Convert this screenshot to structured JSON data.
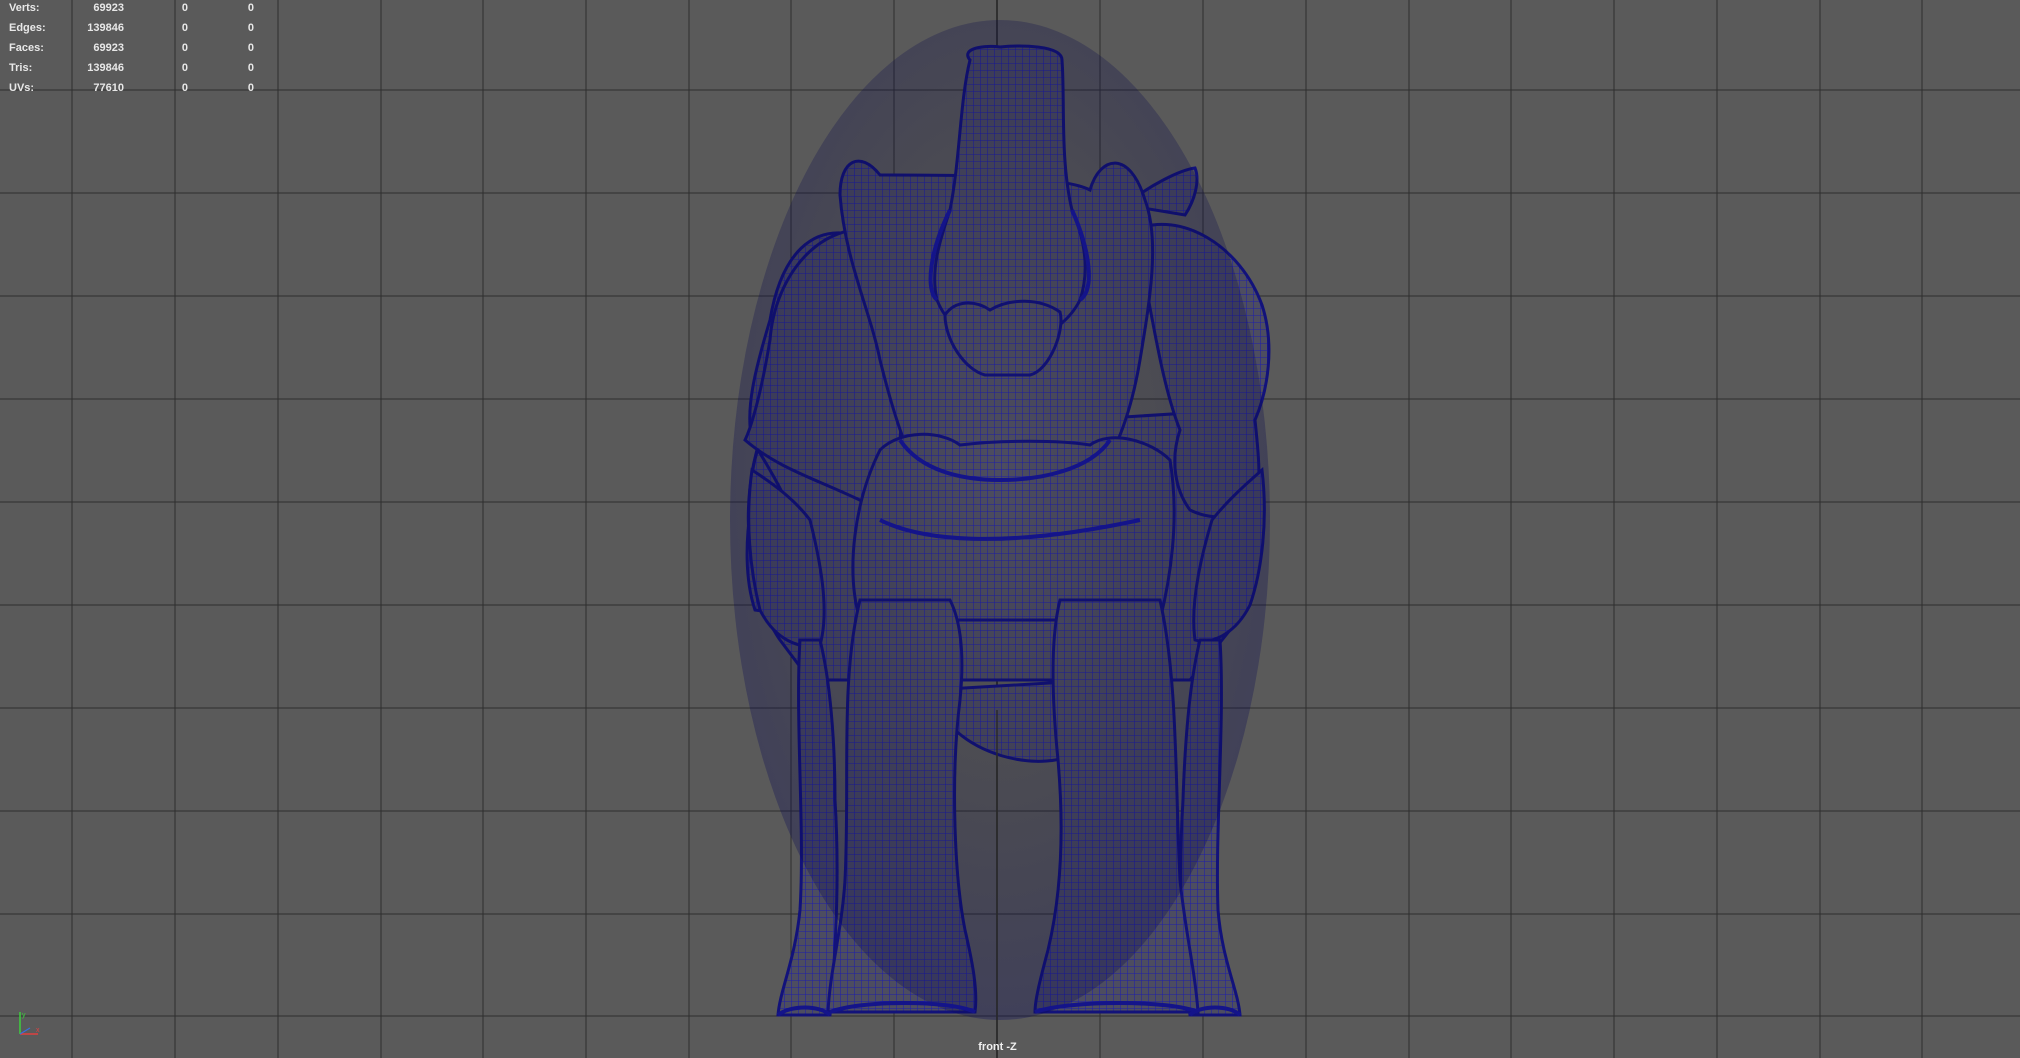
{
  "hud": {
    "rows": [
      {
        "label": "Verts:",
        "total": "69923",
        "selected": "0",
        "visible": "0"
      },
      {
        "label": "Edges:",
        "total": "139846",
        "selected": "0",
        "visible": "0"
      },
      {
        "label": "Faces:",
        "total": "69923",
        "selected": "0",
        "visible": "0"
      },
      {
        "label": "Tris:",
        "total": "139846",
        "selected": "0",
        "visible": "0"
      },
      {
        "label": "UVs:",
        "total": "77610",
        "selected": "0",
        "visible": "0"
      }
    ]
  },
  "viewport": {
    "camera_label": "front -Z",
    "background_color": "#5a5a5a",
    "grid_color": "#2e2e2e",
    "mesh_fill_color": "#4b4b5c",
    "wireframe_color": "#1a1a9c"
  },
  "axis_gizmo": {
    "icon": "axis-gizmo-icon",
    "y_color": "#3ccf3c",
    "x_color": "#e04040"
  }
}
